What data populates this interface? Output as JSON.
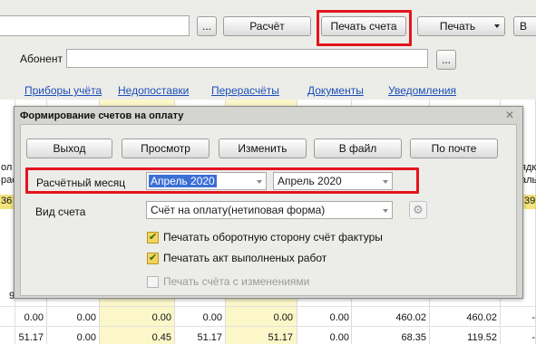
{
  "toolbar": {
    "dots": "...",
    "calc_label": "Расчёт",
    "print_invoice_label": "Печать счета",
    "print_label": "Печать",
    "extra_label": "В"
  },
  "abonent": {
    "label": "Абонент",
    "value": "",
    "dots": "..."
  },
  "tabs": [
    {
      "label": "Приборы учёта"
    },
    {
      "label": "Недопоставки"
    },
    {
      "label": "Перерасчёты"
    },
    {
      "label": "Документы"
    },
    {
      "label": "Уведомления"
    }
  ],
  "grid": {
    "left_header_1": "ол",
    "left_header_2": "рас",
    "left_row_value": "36",
    "right_header_1": "ядк",
    "right_header_2": "аль",
    "right_row_value": "39",
    "left_partial": "9",
    "row1": [
      "0.00",
      "0.00",
      "0.00",
      "0.00",
      "0.00",
      "0.00",
      "460.02",
      "460.02",
      "-"
    ],
    "row2": [
      "51.17",
      "0.00",
      "0.45",
      "51.17",
      "51.17",
      "0.00",
      "68.35",
      "119.52",
      "-"
    ]
  },
  "dialog": {
    "title": "Формирование счетов на оплату",
    "close": "✕",
    "buttons": {
      "exit": "Выход",
      "preview": "Просмотр",
      "edit": "Изменить",
      "to_file": "В файл",
      "by_mail": "По почте"
    },
    "period_label": "Расчётный месяц",
    "period_from": "Апрель 2020",
    "period_to": "Апрель 2020",
    "invoice_type_label": "Вид счета",
    "invoice_type_value": "Счёт на оплату(нетиповая форма)",
    "options": [
      {
        "label": "Печатать оборотную сторону счёт фактуры",
        "checked": true,
        "disabled": false
      },
      {
        "label": "Печатать акт выполненых работ",
        "checked": true,
        "disabled": false
      },
      {
        "label": "Печать счёта с изменениями",
        "checked": false,
        "disabled": true
      }
    ]
  },
  "colors": {
    "highlight": "#e2151f",
    "link": "#1c4fb6",
    "selection": "#3b6fd6",
    "yellow_col": "#fbf7c9"
  }
}
